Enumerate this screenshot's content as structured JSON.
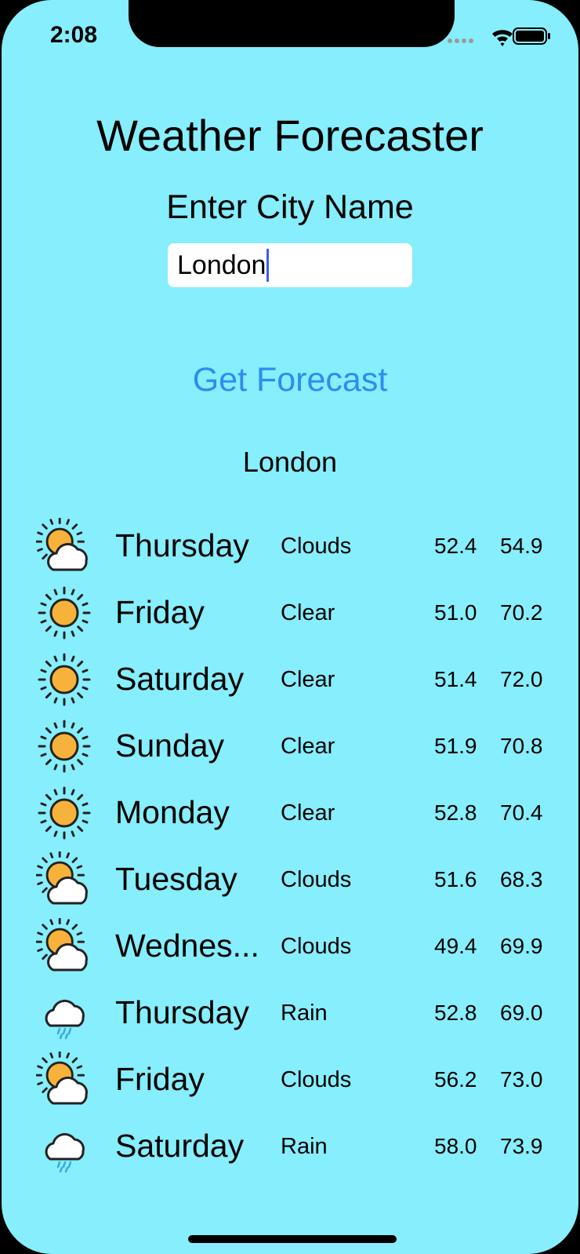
{
  "status_bar": {
    "time": "2:08"
  },
  "header": {
    "title": "Weather Forecaster",
    "subtitle": "Enter City Name"
  },
  "search": {
    "value": "London"
  },
  "actions": {
    "get_forecast_label": "Get Forecast"
  },
  "result": {
    "city": "London"
  },
  "forecast": [
    {
      "day": "Thursday",
      "condition": "Clouds",
      "low": "52.4",
      "high": "54.9",
      "icon": "partly-cloudy-icon"
    },
    {
      "day": "Friday",
      "condition": "Clear",
      "low": "51.0",
      "high": "70.2",
      "icon": "sun-icon"
    },
    {
      "day": "Saturday",
      "condition": "Clear",
      "low": "51.4",
      "high": "72.0",
      "icon": "sun-icon"
    },
    {
      "day": "Sunday",
      "condition": "Clear",
      "low": "51.9",
      "high": "70.8",
      "icon": "sun-icon"
    },
    {
      "day": "Monday",
      "condition": "Clear",
      "low": "52.8",
      "high": "70.4",
      "icon": "sun-icon"
    },
    {
      "day": "Tuesday",
      "condition": "Clouds",
      "low": "51.6",
      "high": "68.3",
      "icon": "partly-cloudy-icon"
    },
    {
      "day": "Wednes...",
      "condition": "Clouds",
      "low": "49.4",
      "high": "69.9",
      "icon": "partly-cloudy-icon"
    },
    {
      "day": "Thursday",
      "condition": "Rain",
      "low": "52.8",
      "high": "69.0",
      "icon": "rain-cloud-icon"
    },
    {
      "day": "Friday",
      "condition": "Clouds",
      "low": "56.2",
      "high": "73.0",
      "icon": "partly-cloudy-icon"
    },
    {
      "day": "Saturday",
      "condition": "Rain",
      "low": "58.0",
      "high": "73.9",
      "icon": "rain-cloud-icon"
    }
  ],
  "colors": {
    "background": "#86eefc",
    "accent": "#2f8cf1",
    "sun": "#f7b23b",
    "rain": "#3aa7e5"
  }
}
